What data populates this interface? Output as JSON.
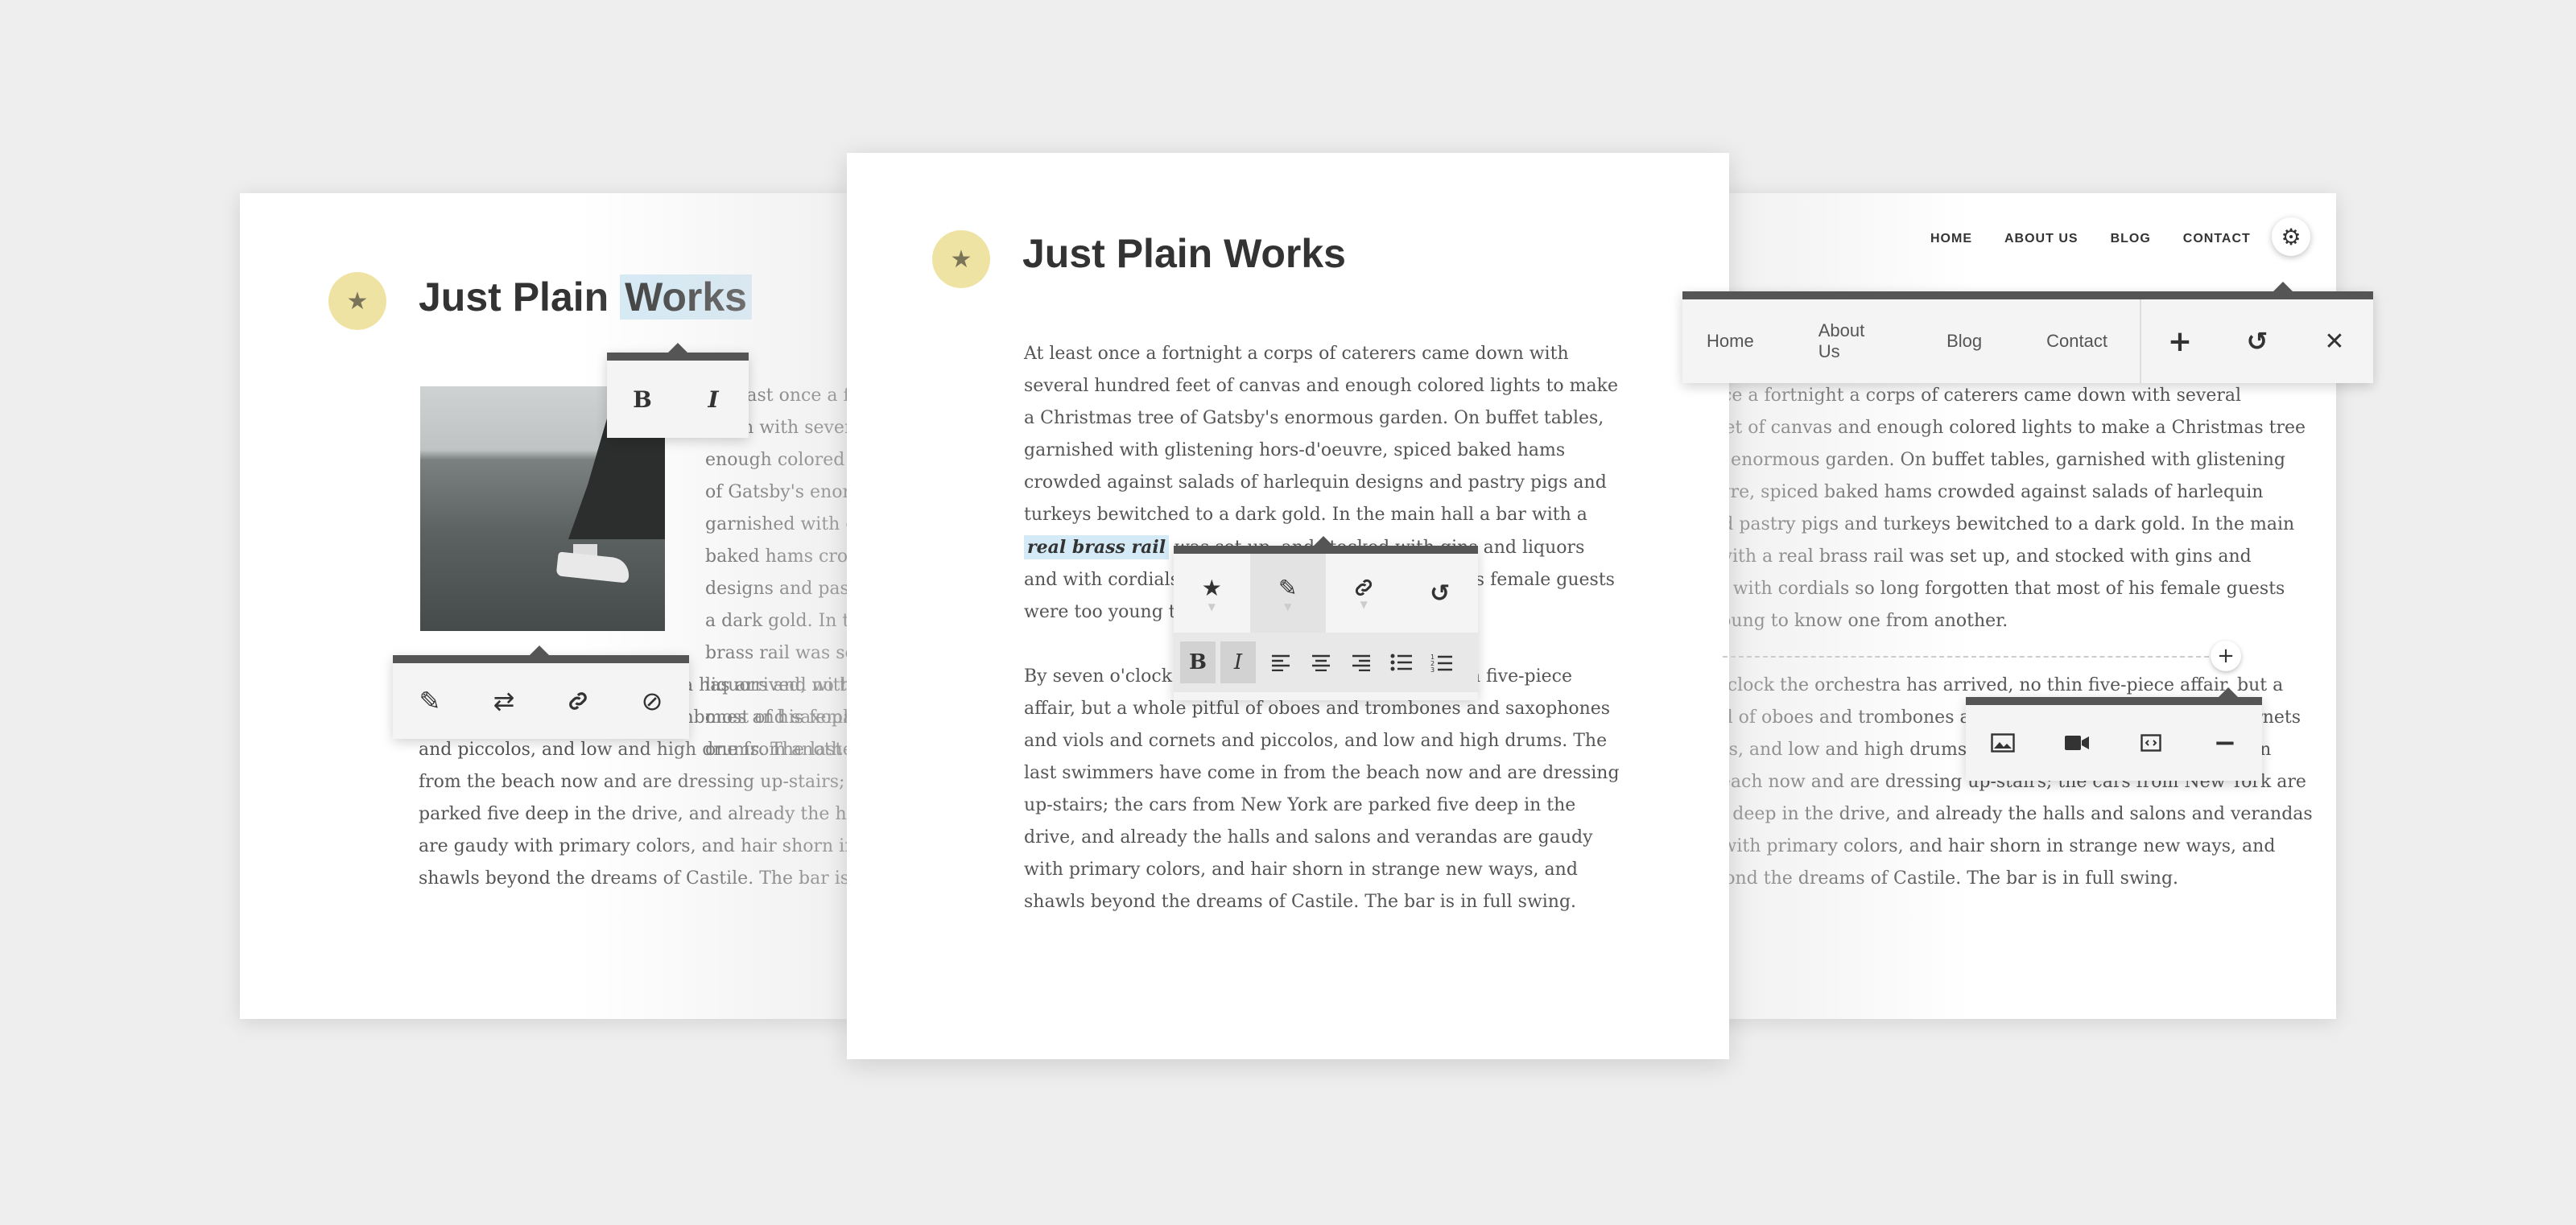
{
  "brand": {
    "title": "Just Plain Works",
    "title_plain": "Just Plain ",
    "title_selected": "Works",
    "badge_icon": "star-icon"
  },
  "paragraph1": {
    "before": "At least once a fortnight a corps of caterers came down with several hundred feet of canvas and enough colored lights to make a Christmas tree of Gatsby's enormous garden. On buffet tables, garnished with glistening hors-d'oeuvre, spiced baked hams crowded against salads of harlequin designs and pastry pigs and turkeys bewitched to a dark gold. In the main hall a bar with a ",
    "highlight": "real brass rail",
    "after": " was set up, and stocked with gins and liquors and with cordials so long forgotten that most of his female guests were too young to know one from another."
  },
  "paragraph2": "By seven o'clock the orchestra has arrived, no thin five-piece affair, but a whole pitful of oboes and trombones and saxophones and viols and cornets and piccolos, and low and high drums. The last swimmers have come in from the beach now and are dressing up-stairs; the cars from New York are parked five deep in the drive, and already the halls and salons and verandas are gaudy with primary colors, and hair shorn in strange new ways, and shawls beyond the dreams of Castile. The bar is in full swing.",
  "left_card": {
    "format_toolbar": {
      "bold": "B",
      "italic": "I"
    },
    "image_toolbar_icons": [
      "edit-icon",
      "swap-icon",
      "link-icon",
      "remove-icon"
    ]
  },
  "center_card": {
    "toolbar_top_icons": [
      "star-icon",
      "pencil-icon",
      "link-icon",
      "undo-icon"
    ],
    "toolbar_bottom": [
      "B",
      "I",
      "align-left-icon",
      "align-center-icon",
      "align-right-icon",
      "bullet-list-icon",
      "numbered-list-icon"
    ]
  },
  "right_card": {
    "top_nav": [
      "HOME",
      "ABOUT US",
      "BLOG",
      "CONTACT"
    ],
    "settings_icon": "gear-icon",
    "menu_editor": {
      "items": [
        "Home",
        "About Us",
        "Blog",
        "Contact"
      ],
      "actions": [
        "plus-icon",
        "undo-icon",
        "close-icon"
      ]
    },
    "insert_toolbar_icons": [
      "image-icon",
      "video-icon",
      "embed-icon",
      "minus-icon"
    ],
    "add_block_icon": "plus-icon"
  },
  "colors": {
    "background": "#eeeeee",
    "badge": "#efe3a4",
    "highlight": "#d4eaf6",
    "toolbar_border": "#555555"
  }
}
